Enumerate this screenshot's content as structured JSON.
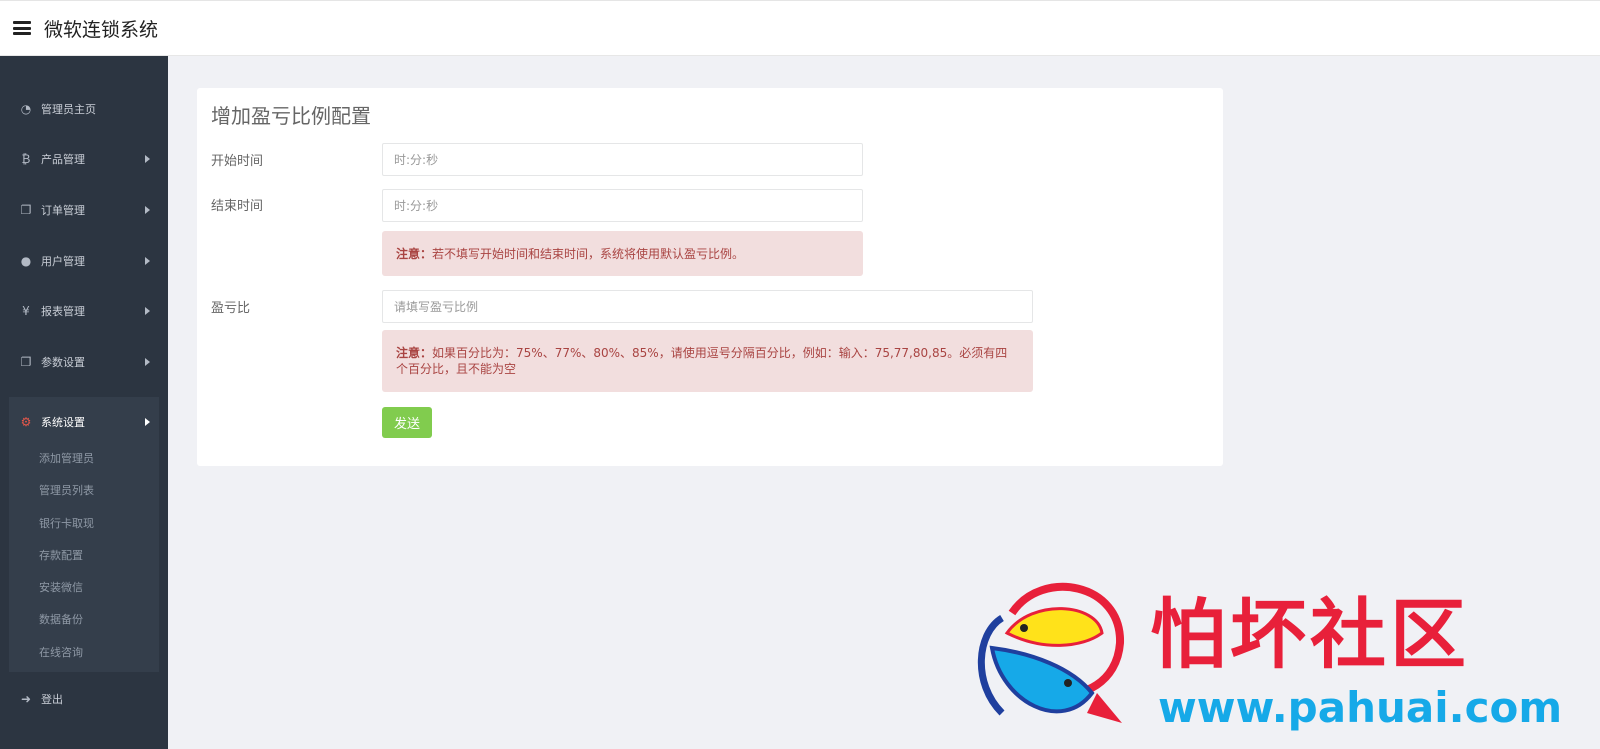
{
  "header": {
    "title": "微软连锁系统",
    "menu_icon": "hamburger-menu-icon"
  },
  "sidebar": {
    "items": [
      {
        "label": "管理员主页",
        "icon": "dashboard-icon",
        "glyph": "◔",
        "has_arrow": false
      },
      {
        "label": "产品管理",
        "icon": "bitcoin-icon",
        "glyph": "₿",
        "has_arrow": true
      },
      {
        "label": "订单管理",
        "icon": "copy-icon",
        "glyph": "❐",
        "has_arrow": true
      },
      {
        "label": "用户管理",
        "icon": "user-icon",
        "glyph": "●",
        "has_arrow": true
      },
      {
        "label": "报表管理",
        "icon": "yen-icon",
        "glyph": "¥",
        "has_arrow": true
      },
      {
        "label": "参数设置",
        "icon": "copy-icon",
        "glyph": "❐",
        "has_arrow": true
      }
    ],
    "active_group": {
      "label": "系统设置",
      "icon": "gears-icon",
      "glyph": "⚙",
      "subitems": [
        "添加管理员",
        "管理员列表",
        "银行卡取现",
        "存款配置",
        "安装微信",
        "数据备份",
        "在线咨询"
      ]
    },
    "logout": {
      "label": "登出",
      "icon": "sign-out-icon",
      "glyph": "➜"
    }
  },
  "form": {
    "title": "增加盈亏比例配置",
    "start_time": {
      "label": "开始时间",
      "placeholder": "时:分:秒",
      "value": ""
    },
    "end_time": {
      "label": "结束时间",
      "placeholder": "时:分:秒",
      "value": ""
    },
    "notice1": {
      "strong": "注意：",
      "text": "若不填写开始时间和结束时间，系统将使用默认盈亏比例。"
    },
    "ratio": {
      "label": "盈亏比",
      "placeholder": "请填写盈亏比例",
      "value": ""
    },
    "notice2": {
      "strong": "注意：",
      "text": "如果百分比为：75%、77%、80%、85%，请使用逗号分隔百分比，例如：输入：75,77,80,85。必须有四个百分比，且不能为空"
    },
    "submit_label": "发送"
  },
  "watermark": {
    "text": "怕坏社区",
    "url": "www.pahuai.com"
  },
  "colors": {
    "sidebar_bg": "#2c3541",
    "active_group_bg": "#343e4b",
    "alert_bg": "#f2dede",
    "alert_text": "#a94442",
    "submit_bg": "#81cc4e",
    "watermark_red": "#e8203a",
    "watermark_blue": "#16a9e8"
  }
}
